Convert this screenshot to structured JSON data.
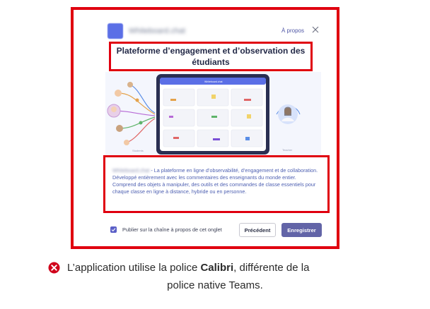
{
  "dialog": {
    "app_name": "Whiteboard.chat",
    "about_link": "À propos",
    "title": "Plateforme d’engagement et d’observation des étudiants",
    "description_app_name": "Whiteboard.chat",
    "description_body": " - La plateforme en ligne d’observabilité, d’engagement et de collaboration. Développé entièrement avec les commentaires des enseignants du monde entier. Comprend des objets à manipuler, des outils et des commandes de classe essentiels pour chaque classe en ligne à distance, hybride ou en personne.",
    "checkbox_label": "Publier sur la chaîne à propos de cet onglet",
    "checkbox_checked": true,
    "prev_button": "Précédent",
    "save_button": "Enregistrer",
    "illustration": {
      "tablet_header": "Whiteboard.chat",
      "students_label": "Students",
      "teacher_label": "Teacher"
    }
  },
  "caption": {
    "icon": "error-icon",
    "part1": "L’application utilise la police ",
    "font_name": "Calibri",
    "part2": ", différente de la",
    "line2": "police native Teams."
  },
  "colors": {
    "highlight_border": "#e0000f",
    "teams_purple": "#6264a7",
    "description_text": "#4d5fb1"
  }
}
